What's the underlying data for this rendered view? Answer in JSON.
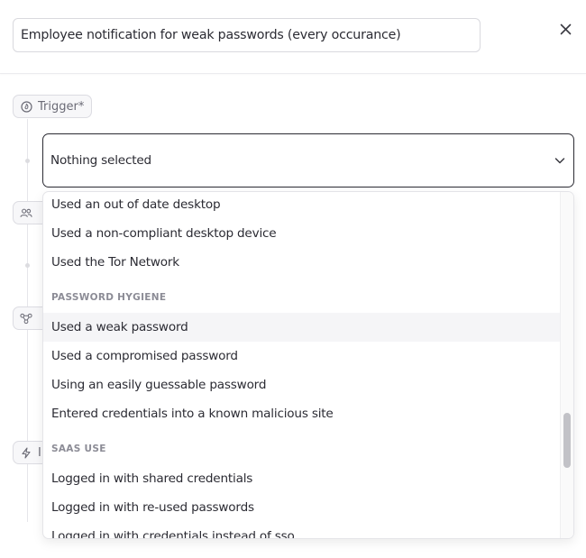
{
  "header": {
    "title_value": "Employee notification for weak passwords (every occurance)",
    "close_icon": "close-icon"
  },
  "trigger": {
    "label": "Trigger*",
    "icon": "fire-icon"
  },
  "steps": [
    {
      "icon": "users-icon",
      "label": ""
    },
    {
      "icon": "workflow-icon",
      "label": ""
    },
    {
      "icon": "lightning-icon",
      "label": "I"
    }
  ],
  "select": {
    "value": "Nothing selected",
    "icon": "chevron-down-icon"
  },
  "dropdown": {
    "items_top": [
      "Used an out of date desktop",
      "Used a non-compliant desktop device",
      "Used the Tor Network"
    ],
    "group_password": "PASSWORD HYGIENE",
    "items_password": [
      "Used a weak password",
      "Used a compromised password",
      "Using an easily guessable password",
      "Entered credentials into a known malicious site"
    ],
    "group_saas": "SAAS USE",
    "items_saas": [
      "Logged in with shared credentials",
      "Logged in with re-used passwords",
      "Logged in with credentials instead of sso"
    ],
    "highlighted": "Used a weak password"
  },
  "colors": {
    "text": "#2b2b33",
    "muted": "#6b6b76",
    "border": "#d9d9de",
    "highlight": "#f5f5f7"
  }
}
